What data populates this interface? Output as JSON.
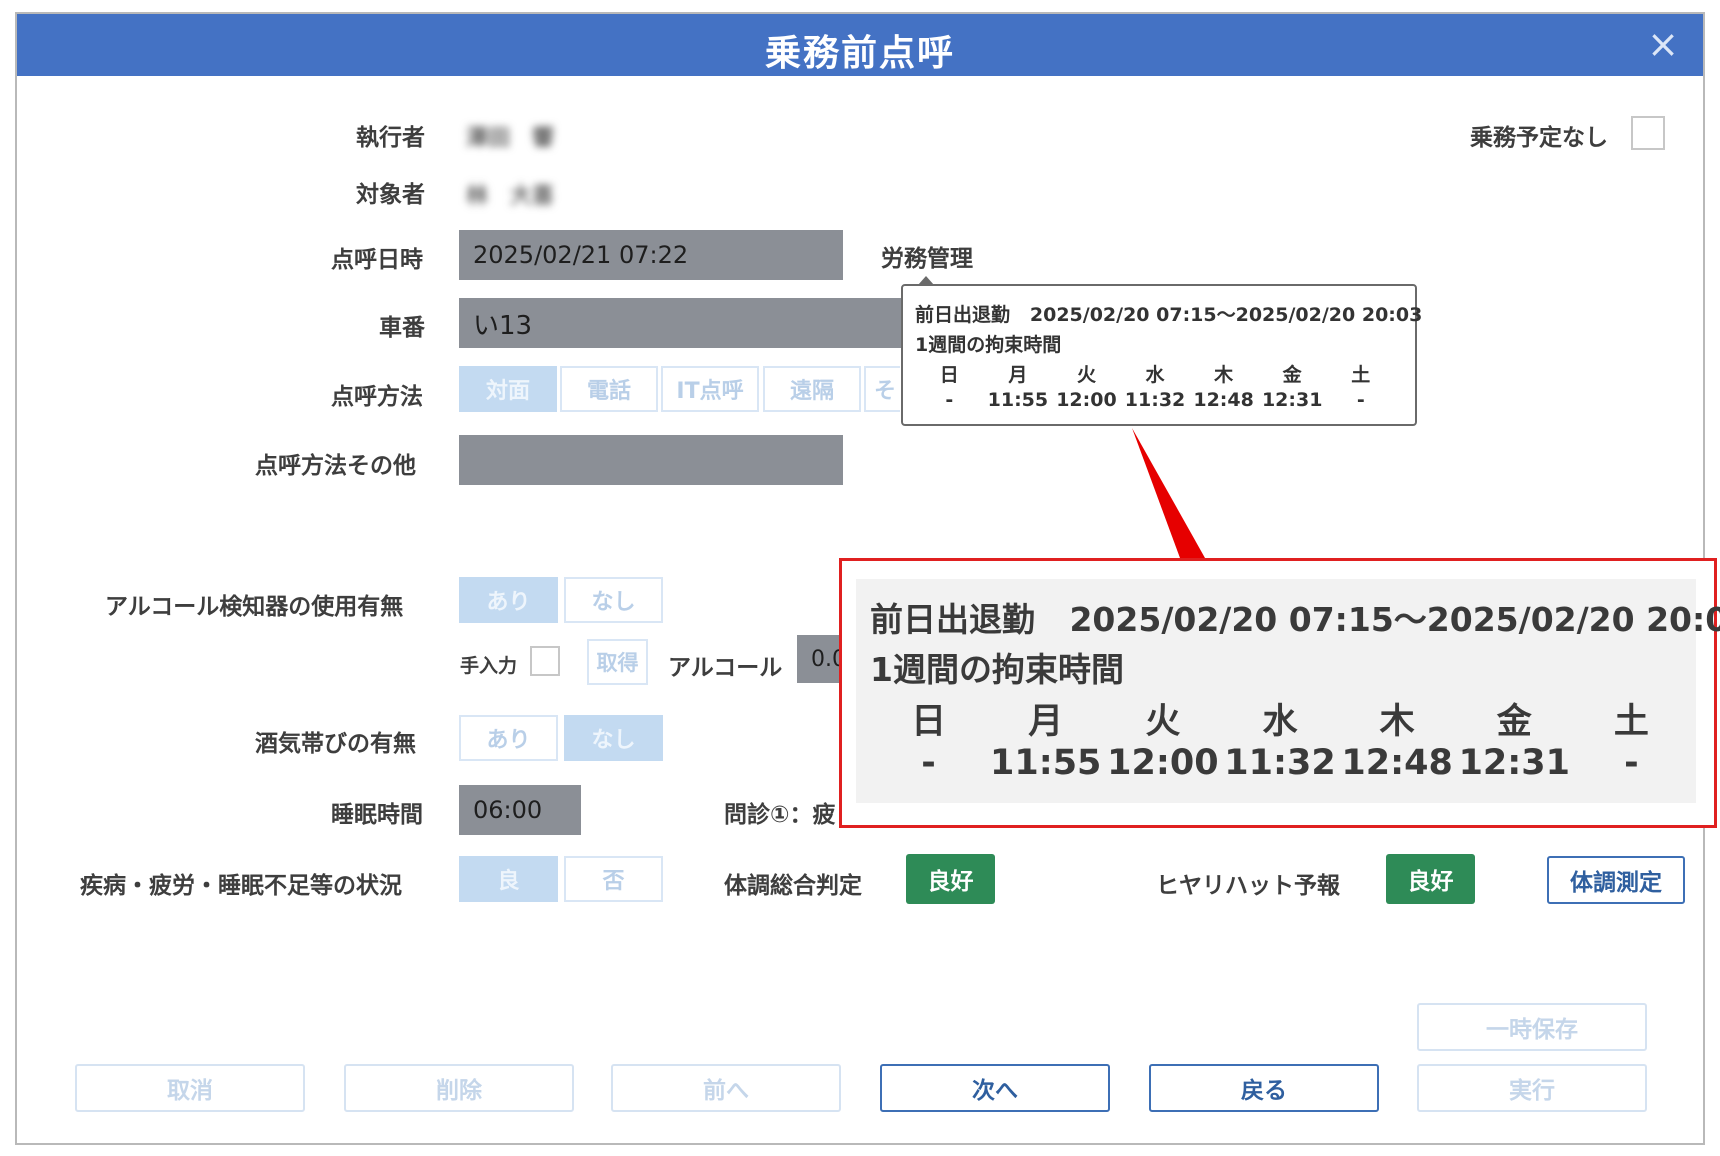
{
  "window": {
    "title": "乗務前点呼",
    "close_icon": "×"
  },
  "labels": {
    "executor": "執行者",
    "target": "対象者",
    "datetime": "点呼日時",
    "car_number": "車番",
    "method": "点呼方法",
    "method_other": "点呼方法その他",
    "alcohol_detector": "アルコール検知器の使用有無",
    "manual_input": "手入力",
    "alcohol": "アルコール",
    "drunk": "酒気帯びの有無",
    "sleep": "睡眠時間",
    "interview": "問診①：疲",
    "condition_status": "疾病・疲労・睡眠不足等の状況",
    "overall_judgment": "体調総合判定",
    "near_miss": "ヒヤリハット予報",
    "no_duty": "乗務予定なし",
    "labor": "労務管理"
  },
  "values": {
    "executor_name": "澤田　響",
    "target_name": "林　大喜",
    "datetime": "2025/02/21 07:22",
    "car_number": "い13",
    "alcohol_value": "0.0",
    "sleep_hours": "06:00",
    "overall_judgment": "良好",
    "near_miss": "良好"
  },
  "method_options": [
    "対面",
    "電話",
    "IT点呼",
    "遠隔",
    "そ"
  ],
  "method_selected": "対面",
  "alcohol_detector_options": {
    "yes": "あり",
    "no": "なし"
  },
  "drunk_options": {
    "yes": "あり",
    "no": "なし"
  },
  "condition_options": {
    "good": "良",
    "bad": "否"
  },
  "get_button": "取得",
  "health_measure_button": "体調測定",
  "tooltip": {
    "prev_day_label": "前日出退勤",
    "prev_day_range": "2025/02/20 07:15～2025/02/20 20:03",
    "weekly_label": "1週間の拘束時間",
    "days": [
      "日",
      "月",
      "火",
      "水",
      "木",
      "金",
      "土"
    ],
    "hours": [
      "-",
      "11:55",
      "12:00",
      "11:32",
      "12:48",
      "12:31",
      "-"
    ]
  },
  "footer": {
    "temp_save": "一時保存",
    "cancel": "取消",
    "delete": "削除",
    "prev": "前へ",
    "next": "次へ",
    "back": "戻る",
    "execute": "実行"
  },
  "colors": {
    "title_bar": "#4472c4",
    "highlight_border": "#e02020",
    "good_badge": "#2e8b57"
  }
}
